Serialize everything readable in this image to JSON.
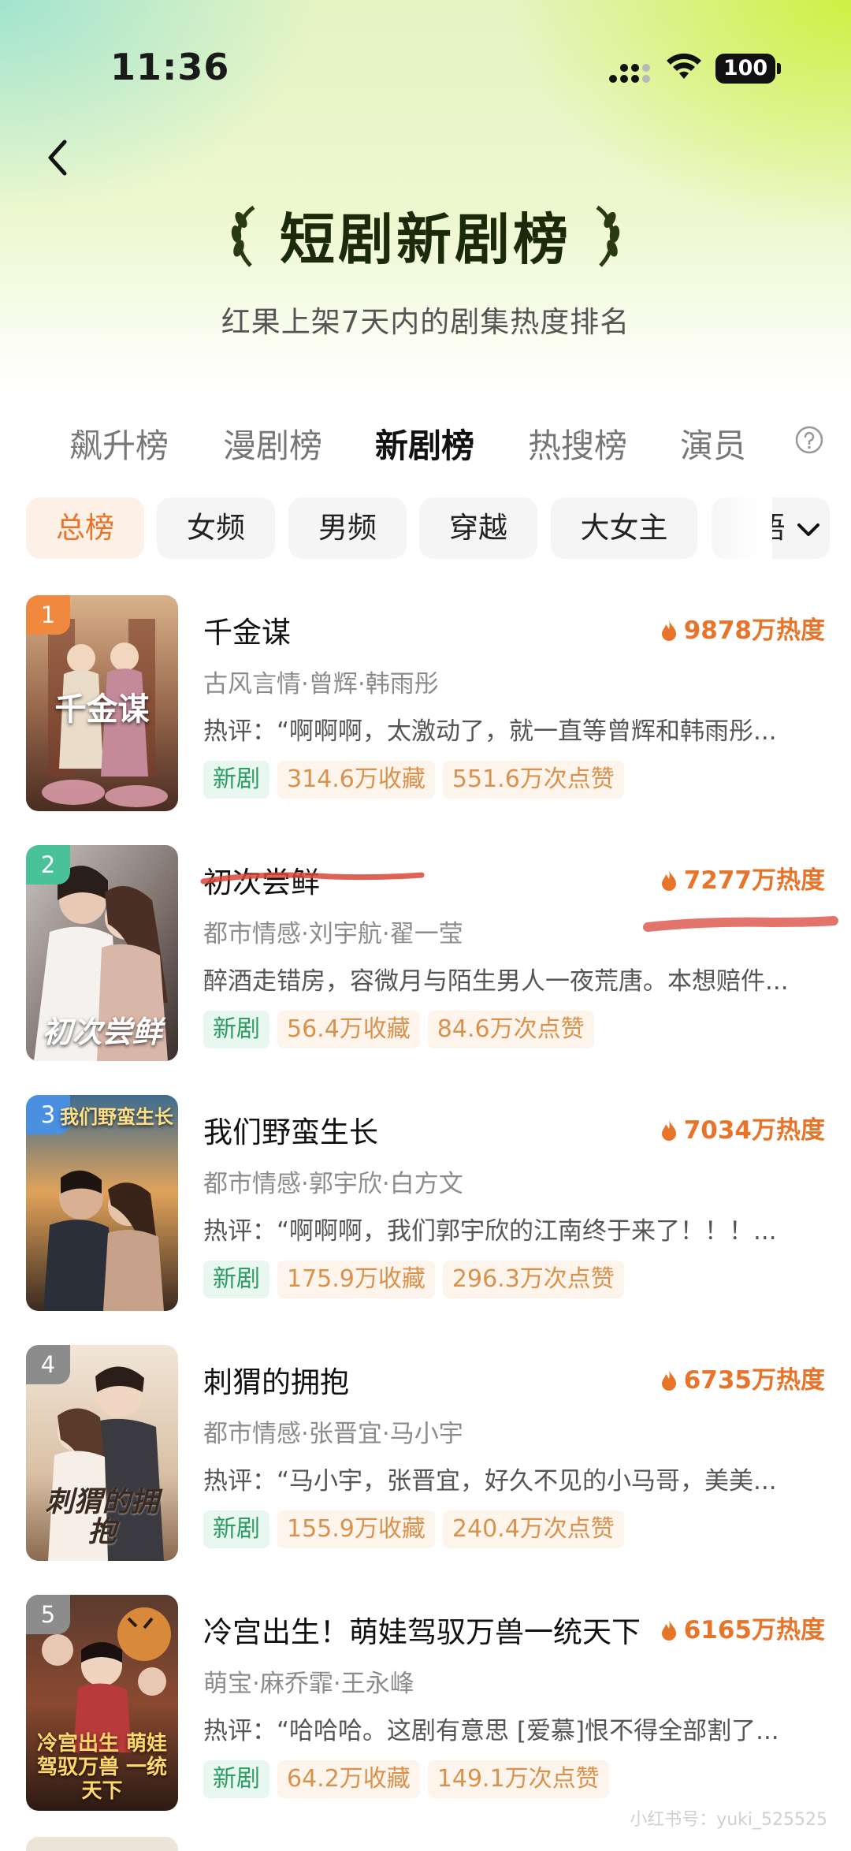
{
  "status_bar": {
    "time": "11:36",
    "battery": "100"
  },
  "header": {
    "title": "短剧新剧榜",
    "subtitle": "红果上架7天内的剧集热度排名"
  },
  "tabs": [
    {
      "label": "飙升榜"
    },
    {
      "label": "漫剧榜"
    },
    {
      "label": "新剧榜",
      "active": true
    },
    {
      "label": "热搜榜"
    },
    {
      "label": "演员"
    }
  ],
  "chips": [
    {
      "label": "总榜",
      "active": true
    },
    {
      "label": "女频"
    },
    {
      "label": "男频"
    },
    {
      "label": "穿越"
    },
    {
      "label": "大女主"
    },
    {
      "label": "语"
    }
  ],
  "items": [
    {
      "rank": "1",
      "title": "千金谋",
      "heat": "9878万热度",
      "meta": "古风言情·曾辉·韩雨彤",
      "comment": "热评：“啊啊啊，太激动了，就一直等曾辉和韩雨彤...",
      "tags": [
        "新剧",
        "314.6万收藏",
        "551.6万次点赞"
      ],
      "cover_text": "千金谋"
    },
    {
      "rank": "2",
      "title": "初次尝鲜",
      "heat": "7277万热度",
      "meta": "都市情感·刘宇航·翟一莹",
      "comment": "醉酒走错房，容微月与陌生男人一夜荒唐。本想赔件...",
      "tags": [
        "新剧",
        "56.4万收藏",
        "84.6万次点赞"
      ],
      "cover_text": "初次尝鲜"
    },
    {
      "rank": "3",
      "title": "我们野蛮生长",
      "heat": "7034万热度",
      "meta": "都市情感·郭宇欣·白方文",
      "comment": "热评：“啊啊啊，我们郭宇欣的江南终于来了！！！...",
      "tags": [
        "新剧",
        "175.9万收藏",
        "296.3万次点赞"
      ],
      "cover_text": "我们野蛮生长"
    },
    {
      "rank": "4",
      "title": "刺猬的拥抱",
      "heat": "6735万热度",
      "meta": "都市情感·张晋宜·马小宇",
      "comment": "热评：“马小宇，张晋宜，好久不见的小马哥，美美...",
      "tags": [
        "新剧",
        "155.9万收藏",
        "240.4万次点赞"
      ],
      "cover_text": "刺猬的拥抱"
    },
    {
      "rank": "5",
      "title": "冷宫出生！萌娃驾驭万兽一统天下",
      "heat": "6165万热度",
      "meta": "萌宝·麻乔霏·王永峰",
      "comment": "热评：“哈哈哈。这剧有意思 [爱慕]恨不得全部割了...",
      "tags": [
        "新剧",
        "64.2万收藏",
        "149.1万次点赞"
      ],
      "cover_text": "冷宫出生 萌娃驾驭万兽 一统天下"
    }
  ],
  "watermark": "小红书号：yuki_525525",
  "colors": {
    "accent_orange": "#e8742a",
    "new_tag_green": "#2e9d63",
    "rank_1": "#f0883e",
    "rank_2": "#49c29a",
    "rank_3": "#4a8fe0",
    "rank_4": "#8c8c8c",
    "rank_5": "#8c8c8c",
    "annotation_red": "#d9463a"
  },
  "icons": [
    "back-icon",
    "laurel-left-icon",
    "laurel-right-icon",
    "help-icon",
    "chevron-down-icon",
    "flame-icon",
    "signal-icon",
    "wifi-icon"
  ]
}
